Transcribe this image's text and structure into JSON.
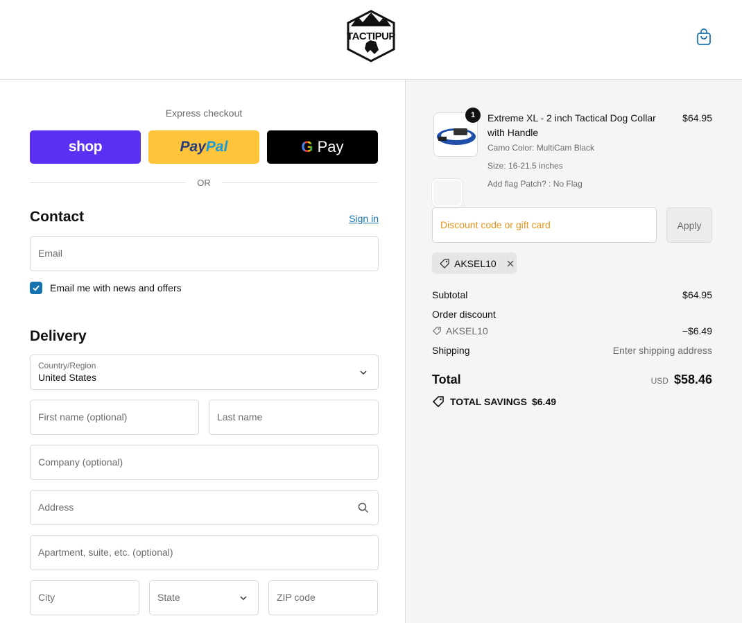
{
  "brand": {
    "name": "TACTIPUP"
  },
  "header": {
    "cart_icon": "shopping-bag-icon"
  },
  "express": {
    "title": "Express checkout",
    "shop_label": "shop",
    "paypal_part1": "Pay",
    "paypal_part2": "Pal",
    "gpay_g": "G",
    "gpay_label": "Pay",
    "or_text": "OR"
  },
  "contact": {
    "title": "Contact",
    "signin": "Sign in",
    "email_placeholder": "Email",
    "newsletter_label": "Email me with news and offers",
    "newsletter_checked": true
  },
  "delivery": {
    "title": "Delivery",
    "country_label": "Country/Region",
    "country_value": "United States",
    "first_name": "First name (optional)",
    "last_name": "Last name",
    "company": "Company (optional)",
    "address": "Address",
    "apartment": "Apartment, suite, etc. (optional)",
    "city": "City",
    "state": "State",
    "zip": "ZIP code"
  },
  "order": {
    "item": {
      "quantity": "1",
      "title": "Extreme XL - 2 inch Tactical Dog Collar with Handle",
      "color": "Camo Color: MultiCam Black",
      "size": "Size: 16-21.5 inches",
      "patch": "Add flag Patch? : No Flag",
      "price": "$64.95"
    },
    "discount_placeholder": "Discount code or gift card",
    "apply_label": "Apply",
    "applied_code": "AKSEL10",
    "subtotal_label": "Subtotal",
    "subtotal_value": "$64.95",
    "order_discount_label": "Order discount",
    "discount_code": "AKSEL10",
    "discount_value": "−$6.49",
    "shipping_label": "Shipping",
    "shipping_value": "Enter shipping address",
    "total_label": "Total",
    "currency": "USD",
    "total_value": "$58.46",
    "savings_label": "TOTAL SAVINGS",
    "savings_value": "$6.49"
  },
  "colors": {
    "shop": "#5a31f4",
    "paypal": "#ffc439",
    "gpay": "#000000",
    "link": "#1773b0",
    "discount_placeholder": "#e8941a"
  }
}
